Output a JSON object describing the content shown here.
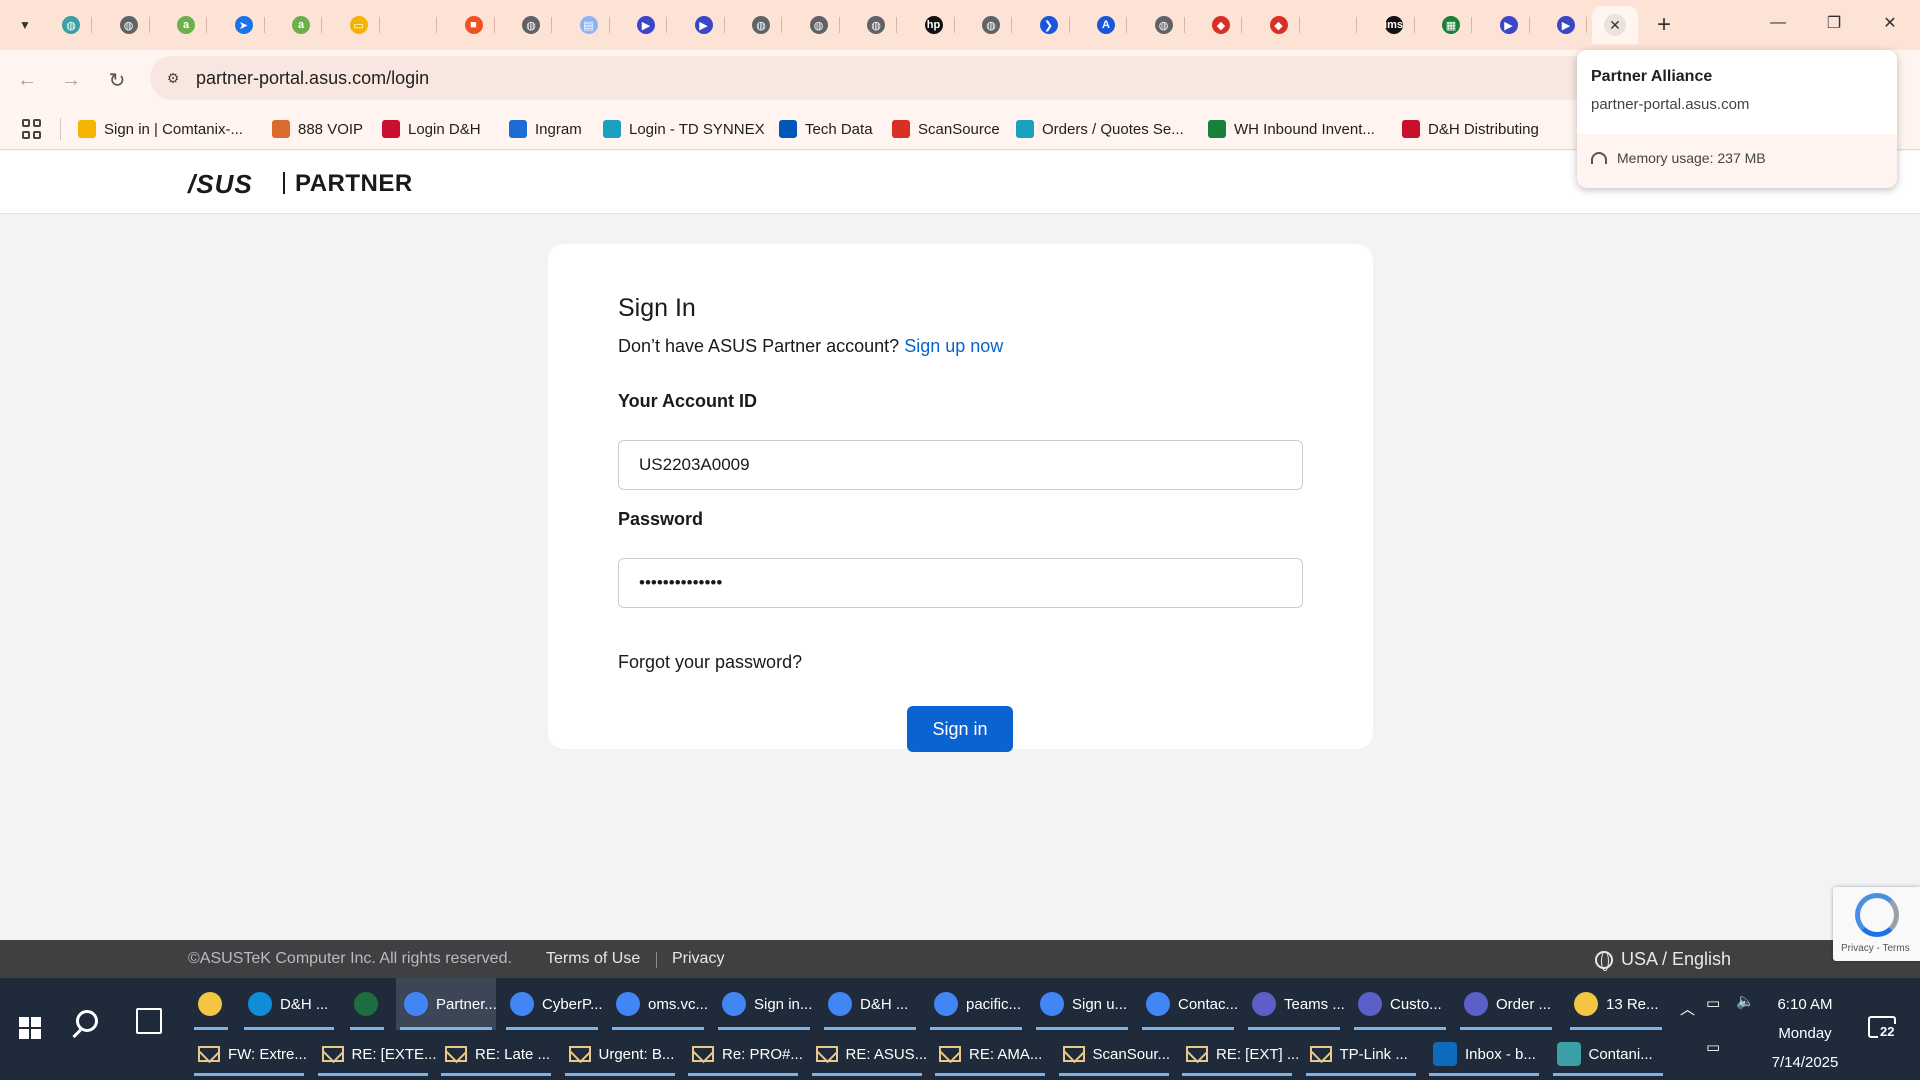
{
  "browser": {
    "tabs": [
      {
        "icon": "globe-icon",
        "color": "#3aa0a6"
      },
      {
        "icon": "globe-icon",
        "color": "#5f6368"
      },
      {
        "icon": "amazon-icon",
        "color": "#6ab04c"
      },
      {
        "icon": "compass-icon",
        "color": "#1a73e8"
      },
      {
        "icon": "amazon-icon",
        "color": "#6ab04c"
      },
      {
        "icon": "slides-icon",
        "color": "#f4b400"
      },
      {
        "icon": "blank-icon",
        "color": "#fde3d6"
      },
      {
        "icon": "microsoft-icon",
        "color": "#f25022"
      },
      {
        "icon": "globe-icon",
        "color": "#5f6368"
      },
      {
        "icon": "document-icon",
        "color": "#8ab4f8"
      },
      {
        "icon": "partner-icon",
        "color": "#3b47c6"
      },
      {
        "icon": "partner-icon",
        "color": "#3b47c6"
      },
      {
        "icon": "globe-icon",
        "color": "#5f6368"
      },
      {
        "icon": "globe-icon",
        "color": "#5f6368"
      },
      {
        "icon": "globe-icon",
        "color": "#5f6368"
      },
      {
        "icon": "hp-icon",
        "color": "#111111"
      },
      {
        "icon": "globe-icon",
        "color": "#5f6368"
      },
      {
        "icon": "chevron-icon",
        "color": "#1a56db"
      },
      {
        "icon": "a-logo-icon",
        "color": "#1a56db"
      },
      {
        "icon": "globe-icon",
        "color": "#5f6368"
      },
      {
        "icon": "shield-icon",
        "color": "#d93025"
      },
      {
        "icon": "shield-icon",
        "color": "#d93025"
      },
      {
        "icon": "blank-icon",
        "color": "#fde3d6"
      },
      {
        "icon": "ims-icon",
        "color": "#111111"
      },
      {
        "icon": "sheet-icon",
        "color": "#188038"
      },
      {
        "icon": "partner-icon",
        "color": "#3b47c6"
      },
      {
        "icon": "partner-icon",
        "color": "#3b47c6"
      }
    ],
    "url": "partner-portal.asus.com/login",
    "bookmarks": [
      {
        "label": "Sign in | Comtanix-...",
        "icon": "w-icon",
        "color": "#f4b400"
      },
      {
        "label": "888 VOIP",
        "icon": "voip-icon",
        "color": "#d96c2c"
      },
      {
        "label": "Login D&H",
        "icon": "dh-icon",
        "color": "#c8102e"
      },
      {
        "label": "Ingram",
        "icon": "ingram-icon",
        "color": "#1e6bd6"
      },
      {
        "label": "Login - TD SYNNEX",
        "icon": "synnex-icon",
        "color": "#1aa1c1"
      },
      {
        "label": "Tech Data",
        "icon": "techdata-icon",
        "color": "#0057b8"
      },
      {
        "label": "ScanSource",
        "icon": "scansource-icon",
        "color": "#d93025"
      },
      {
        "label": "Orders / Quotes Se...",
        "icon": "synnex-icon",
        "color": "#1aa1c1"
      },
      {
        "label": "WH Inbound Invent...",
        "icon": "sheet-icon",
        "color": "#188038"
      },
      {
        "label": "D&H Distributing",
        "icon": "dh-icon",
        "color": "#c8102e"
      }
    ]
  },
  "popup": {
    "title": "Partner Alliance",
    "host": "partner-portal.asus.com",
    "memory": "Memory usage: 237 MB"
  },
  "site": {
    "logo": "/SUS",
    "logo_partner": "PARTNER"
  },
  "signin": {
    "title": "Sign In",
    "no_account": "Don’t have ASUS Partner account?",
    "signup_link": "Sign up now",
    "account_label": "Your Account ID",
    "account_value": "US2203A0009",
    "password_label": "Password",
    "password_value": "••••••••••••••",
    "forgot": "Forgot your password?",
    "button": "Sign in"
  },
  "footer": {
    "copyright": "©ASUSTeK Computer Inc. All rights reserved.",
    "terms": "Terms of Use",
    "privacy": "Privacy",
    "language": "USA / English",
    "recaptcha": "Privacy - Terms"
  },
  "taskbar": {
    "row1": [
      {
        "label": "",
        "icon": "file-explorer-icon",
        "color": "#f4c542"
      },
      {
        "label": "D&H ...",
        "icon": "edge-icon",
        "color": "#0f8dd8"
      },
      {
        "label": "",
        "icon": "excel-icon",
        "color": "#1d6f42"
      },
      {
        "label": "Partner...",
        "icon": "chrome-icon",
        "color": "#4285f4"
      },
      {
        "label": "CyberP...",
        "icon": "chrome-icon",
        "color": "#4285f4"
      },
      {
        "label": "oms.vc...",
        "icon": "chrome-icon",
        "color": "#4285f4"
      },
      {
        "label": "Sign in...",
        "icon": "chrome-icon",
        "color": "#4285f4"
      },
      {
        "label": "D&H ...",
        "icon": "chrome-icon",
        "color": "#4285f4"
      },
      {
        "label": "pacific...",
        "icon": "chrome-icon",
        "color": "#4285f4"
      },
      {
        "label": "Sign u...",
        "icon": "chrome-icon",
        "color": "#4285f4"
      },
      {
        "label": "Contac...",
        "icon": "chrome-icon",
        "color": "#4285f4"
      },
      {
        "label": "Teams ...",
        "icon": "teams-icon",
        "color": "#5b5fc7"
      },
      {
        "label": "Custo...",
        "icon": "teams-icon",
        "color": "#5b5fc7"
      },
      {
        "label": "Order ...",
        "icon": "teams-icon",
        "color": "#5b5fc7"
      },
      {
        "label": "13 Re...",
        "icon": "bell-icon",
        "color": "#f4c542"
      }
    ],
    "row2": [
      {
        "label": "FW: Extre...",
        "icon": "mail-icon"
      },
      {
        "label": "RE: [EXTE...",
        "icon": "mail-icon"
      },
      {
        "label": "RE: Late ...",
        "icon": "mail-icon"
      },
      {
        "label": "Urgent: B...",
        "icon": "mail-icon"
      },
      {
        "label": "Re: PRO#...",
        "icon": "mail-icon"
      },
      {
        "label": "RE: ASUS...",
        "icon": "mail-icon"
      },
      {
        "label": "RE: AMA...",
        "icon": "mail-icon"
      },
      {
        "label": "ScanSour...",
        "icon": "mail-icon"
      },
      {
        "label": "RE: [EXT] ...",
        "icon": "mail-icon"
      },
      {
        "label": "TP-Link ...",
        "icon": "mail-icon"
      },
      {
        "label": "Inbox - b...",
        "icon": "outlook-icon"
      },
      {
        "label": "Contani...",
        "icon": "app-icon"
      }
    ],
    "time": "6:10 AM",
    "day": "Monday",
    "date": "7/14/2025",
    "notifications": "22"
  }
}
